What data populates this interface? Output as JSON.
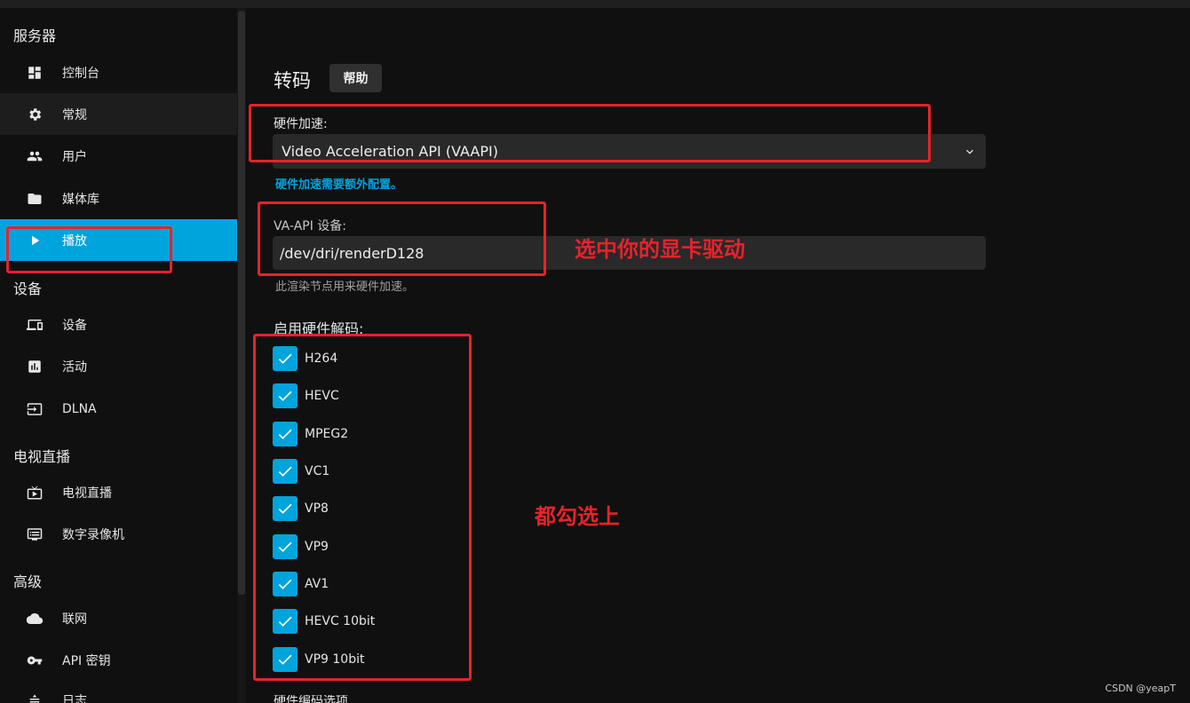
{
  "sidebar": {
    "sections": [
      {
        "title": "服务器"
      },
      {
        "title": "设备"
      },
      {
        "title": "电视直播"
      },
      {
        "title": "高级"
      }
    ],
    "items": [
      {
        "label": "控制台",
        "icon": "dashboard-icon"
      },
      {
        "label": "常规",
        "icon": "gear-icon"
      },
      {
        "label": "用户",
        "icon": "users-icon"
      },
      {
        "label": "媒体库",
        "icon": "folder-icon"
      },
      {
        "label": "播放",
        "icon": "play-icon"
      },
      {
        "label": "设备",
        "icon": "devices-icon"
      },
      {
        "label": "活动",
        "icon": "activity-icon"
      },
      {
        "label": "DLNA",
        "icon": "input-icon"
      },
      {
        "label": "电视直播",
        "icon": "live-tv-icon"
      },
      {
        "label": "数字录像机",
        "icon": "dvr-icon"
      },
      {
        "label": "联网",
        "icon": "cloud-icon"
      },
      {
        "label": "API 密钥",
        "icon": "key-icon"
      },
      {
        "label": "日志",
        "icon": "log-icon"
      }
    ],
    "active_item": "播放",
    "selected_item": "常规"
  },
  "main": {
    "title": "转码",
    "help_button": "帮助",
    "hw_accel": {
      "label": "硬件加速:",
      "value": "Video Acceleration API (VAAPI)",
      "help_link": "硬件加速需要额外配置。"
    },
    "vaapi_device": {
      "label": "VA-API 设备:",
      "value": "/dev/dri/renderD128",
      "help": "此渲染节点用来硬件加速。"
    },
    "decode": {
      "title": "启用硬件解码:",
      "codecs": [
        {
          "label": "H264",
          "checked": true
        },
        {
          "label": "HEVC",
          "checked": true
        },
        {
          "label": "MPEG2",
          "checked": true
        },
        {
          "label": "VC1",
          "checked": true
        },
        {
          "label": "VP8",
          "checked": true
        },
        {
          "label": "VP9",
          "checked": true
        },
        {
          "label": "AV1",
          "checked": true
        },
        {
          "label": "HEVC 10bit",
          "checked": true
        },
        {
          "label": "VP9 10bit",
          "checked": true
        }
      ]
    },
    "cut_off_label": "硬件编码选项"
  },
  "annotations": {
    "select_driver": "选中你的显卡驱动",
    "check_all": "都勾选上"
  },
  "watermark": "CSDN @yeapT",
  "colors": {
    "accent": "#00a4dc",
    "annotation": "#e8222b",
    "background": "#101010"
  }
}
